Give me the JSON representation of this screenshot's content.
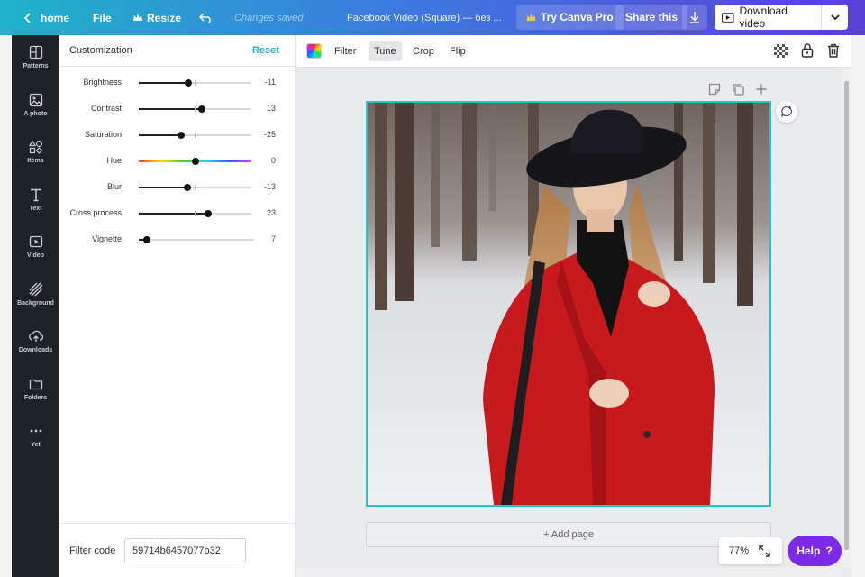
{
  "topbar": {
    "home": "home",
    "file": "File",
    "resize": "Resize",
    "status": "Changes saved",
    "title": "Facebook Video (Square) — без ...",
    "try_pro": "Try Canva Pro",
    "share": "Share this",
    "download": "Download video"
  },
  "rail": {
    "items": [
      {
        "label": "Patterns",
        "icon": "patterns-icon"
      },
      {
        "label": "A photo",
        "icon": "photo-icon"
      },
      {
        "label": "Items",
        "icon": "items-icon"
      },
      {
        "label": "Text",
        "icon": "text-icon"
      },
      {
        "label": "Video",
        "icon": "video-icon"
      },
      {
        "label": "Background",
        "icon": "background-icon"
      },
      {
        "label": "Downloads",
        "icon": "upload-icon"
      },
      {
        "label": "Folders",
        "icon": "folder-icon"
      },
      {
        "label": "Yet",
        "icon": "more-icon"
      }
    ]
  },
  "panel": {
    "title": "Customization",
    "reset": "Reset",
    "sliders": [
      {
        "label": "Brightness",
        "value": "-11"
      },
      {
        "label": "Contrast",
        "value": "13"
      },
      {
        "label": "Saturation",
        "value": "-25"
      },
      {
        "label": "Hue",
        "value": "0"
      },
      {
        "label": "Blur",
        "value": "-13"
      },
      {
        "label": "Cross process",
        "value": "23"
      },
      {
        "label": "Vignette",
        "value": "7"
      }
    ],
    "filter_code_label": "Filter code",
    "filter_code": "59714b6457077b32"
  },
  "toolbar": {
    "filter": "Filter",
    "tune": "Tune",
    "crop": "Crop",
    "flip": "Flip"
  },
  "canvas": {
    "add_page": "+ Add page",
    "zoom": "77%",
    "help": "Help",
    "help_icon": "?"
  },
  "colors": {
    "accent": "#22c4c9",
    "help": "#7d2ae8",
    "coat": "#c8191c"
  }
}
